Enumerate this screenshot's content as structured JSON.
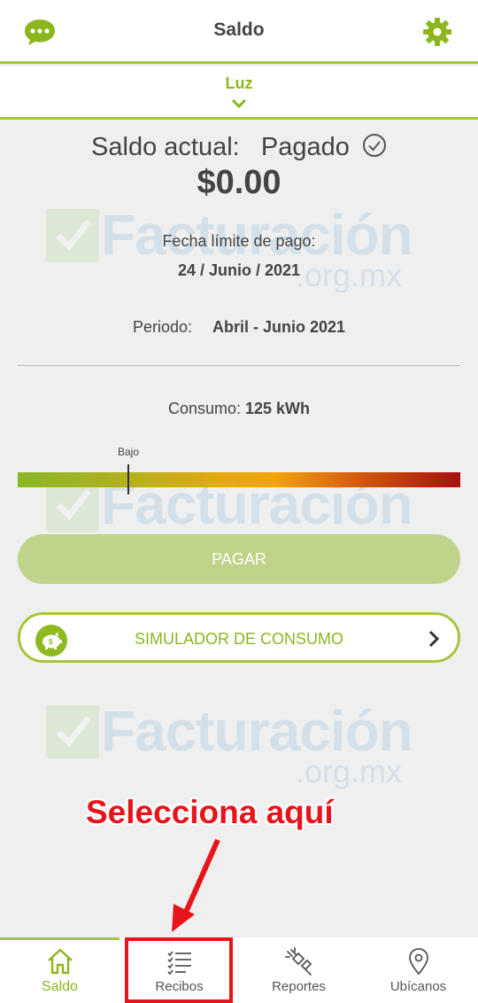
{
  "header": {
    "title": "Saldo",
    "left_icon": "chat-icon",
    "right_icon": "gear-icon"
  },
  "service": {
    "label": "Luz",
    "icon": "chevron-down-icon"
  },
  "watermark": {
    "main": "Facturación",
    "sub": ".org.mx"
  },
  "balance": {
    "label": "Saldo actual:",
    "status": "Pagado",
    "amount": "$0.00",
    "due_label": "Fecha límite de pago:",
    "due_date": "24 / Junio / 2021",
    "period_label": "Periodo:",
    "period_value": "Abril - Junio 2021"
  },
  "consumption": {
    "label": "Consumo:",
    "value": "125 kWh",
    "level_label": "Bajo",
    "level_fraction": 0.25
  },
  "buttons": {
    "pay_label": "PAGAR",
    "simulator_label": "SIMULADOR DE CONSUMO"
  },
  "annotation": {
    "callout": "Selecciona aquí",
    "color": "#e8141b"
  },
  "bottom_nav": {
    "items": [
      {
        "label": "Saldo",
        "icon": "home-icon"
      },
      {
        "label": "Recibos",
        "icon": "checklist-icon"
      },
      {
        "label": "Reportes",
        "icon": "unplugged-icon"
      },
      {
        "label": "Ubícanos",
        "icon": "location-pin-icon"
      }
    ]
  },
  "colors": {
    "accent": "#8cb61e",
    "border": "#a6c63a",
    "background": "#efefef"
  }
}
